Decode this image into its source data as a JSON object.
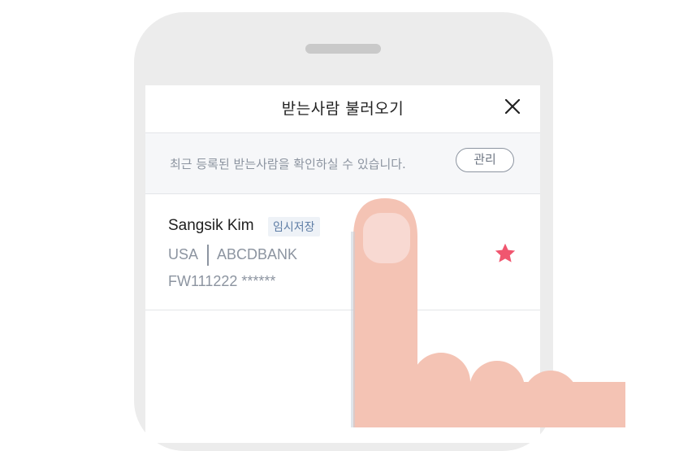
{
  "dialog": {
    "title": "받는사람 불러오기",
    "close_icon": "close-icon"
  },
  "notice": {
    "text": "최근 등록된 받는사람을 확인하실 수 있습니다.",
    "manage_label": "관리"
  },
  "recipients": [
    {
      "name": "Sangsik Kim",
      "badge": "임시저장",
      "country": "USA",
      "bank": "ABCDBANK",
      "account": "FW111222 ******",
      "favorite": true,
      "favorite_icon": "star-icon"
    }
  ],
  "colors": {
    "star": "#f0566f",
    "badge_bg": "#eef2f7",
    "badge_text": "#5f7ea6",
    "secondary_text": "#8c94a0",
    "finger_skin": "#f4c3b4",
    "fingernail": "#f8d9d2"
  },
  "overlay": {
    "gesture_icon": "tapping-finger-hand"
  }
}
